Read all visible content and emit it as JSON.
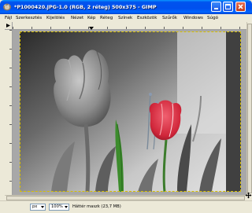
{
  "window": {
    "title": "*P1000420.JPG-1.0 (RGB, 2 réteg) 500x375 - GIMP"
  },
  "menu": {
    "items": [
      "Fájl",
      "Szerkesztés",
      "Kijelölés",
      "Nézet",
      "Kép",
      "Réteg",
      "Színek",
      "Eszközök",
      "Szűrők",
      "Windows",
      "Súgó"
    ]
  },
  "statusbar": {
    "unit": "px",
    "zoom": "100%",
    "message": "Háttér maszk (23,7 MB)"
  },
  "colors": {
    "titlebar": "#0054e3",
    "chrome": "#ece9d8",
    "canvas_bg": "#a8a8a8",
    "tulip_red": "#d8263a",
    "stem_green": "#3c8c2c"
  },
  "icons": [
    "gimp-app-icon",
    "minimize-icon",
    "maximize-icon",
    "close-icon",
    "menu-arrow-icon",
    "navigate-icon"
  ]
}
